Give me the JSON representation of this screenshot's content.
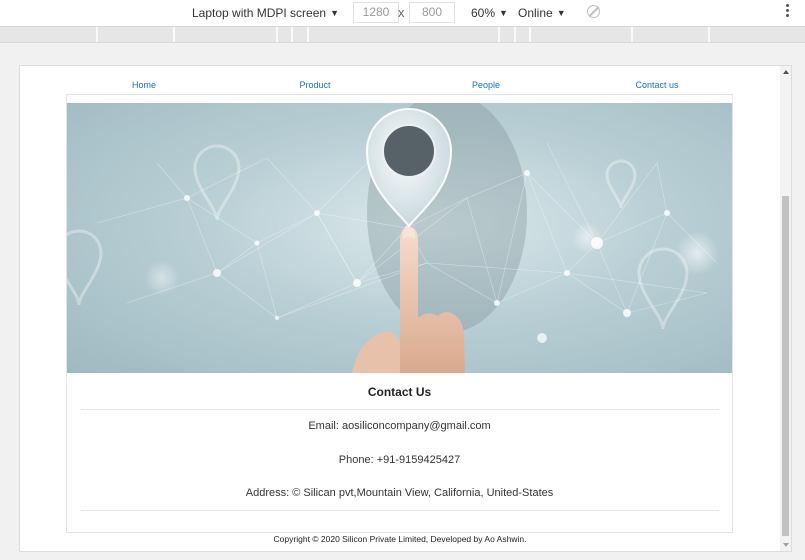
{
  "devtools": {
    "device_label": "Laptop with MDPI screen",
    "width_value": "1280",
    "height_value": "800",
    "dimension_separator": "x",
    "zoom_label": "60%",
    "network_label": "Online"
  },
  "site": {
    "nav": [
      {
        "label": "Home"
      },
      {
        "label": "Product"
      },
      {
        "label": "People"
      },
      {
        "label": "Contact us"
      }
    ],
    "contact": {
      "title": "Contact Us",
      "email": "Email: aosiliconcompany@gmail.com",
      "phone": "Phone: +91-9159425427",
      "address": "Address: © Silican pvt,Mountain View, California, United-States"
    },
    "footer": {
      "copyright": "Copyright © 2020 Silicon Private Limited, Developed by Ao Ashwin."
    }
  },
  "colors": {
    "link": "#1a6fc4",
    "hero_base": "#b9cfd5"
  },
  "icons": {
    "hero": "location-pin-finger-network-image",
    "throttle": "no-throttle-icon",
    "menu": "more-vertical-icon"
  }
}
